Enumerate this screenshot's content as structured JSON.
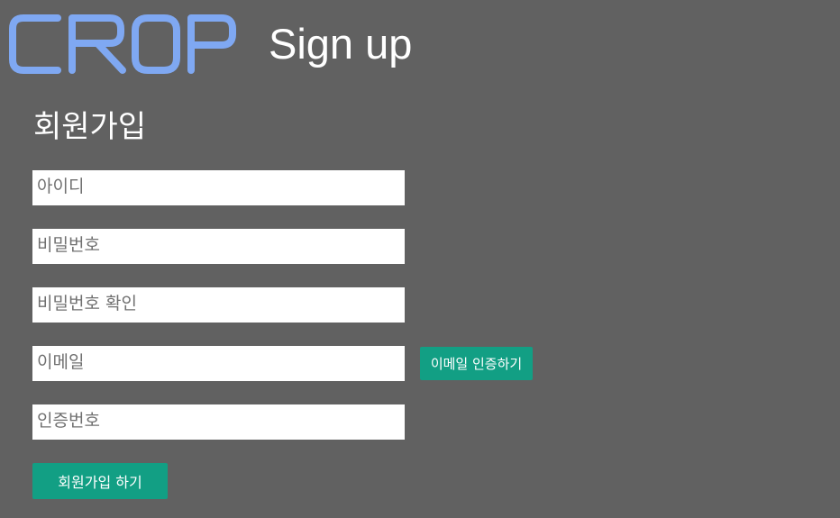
{
  "header": {
    "logo_text": "CROP",
    "title": "Sign up"
  },
  "form": {
    "heading": "회원가입",
    "fields": [
      {
        "placeholder": "아이디",
        "value": ""
      },
      {
        "placeholder": "비밀번호",
        "value": ""
      },
      {
        "placeholder": "비밀번호 확인",
        "value": ""
      },
      {
        "placeholder": "이메일",
        "value": ""
      },
      {
        "placeholder": "인증번호",
        "value": ""
      }
    ],
    "verify_email_label": "이메일 인증하기",
    "submit_label": "회원가입 하기"
  },
  "colors": {
    "background": "#616161",
    "logo": "#7fa8f2",
    "button": "#129f84",
    "text": "#ffffff"
  }
}
